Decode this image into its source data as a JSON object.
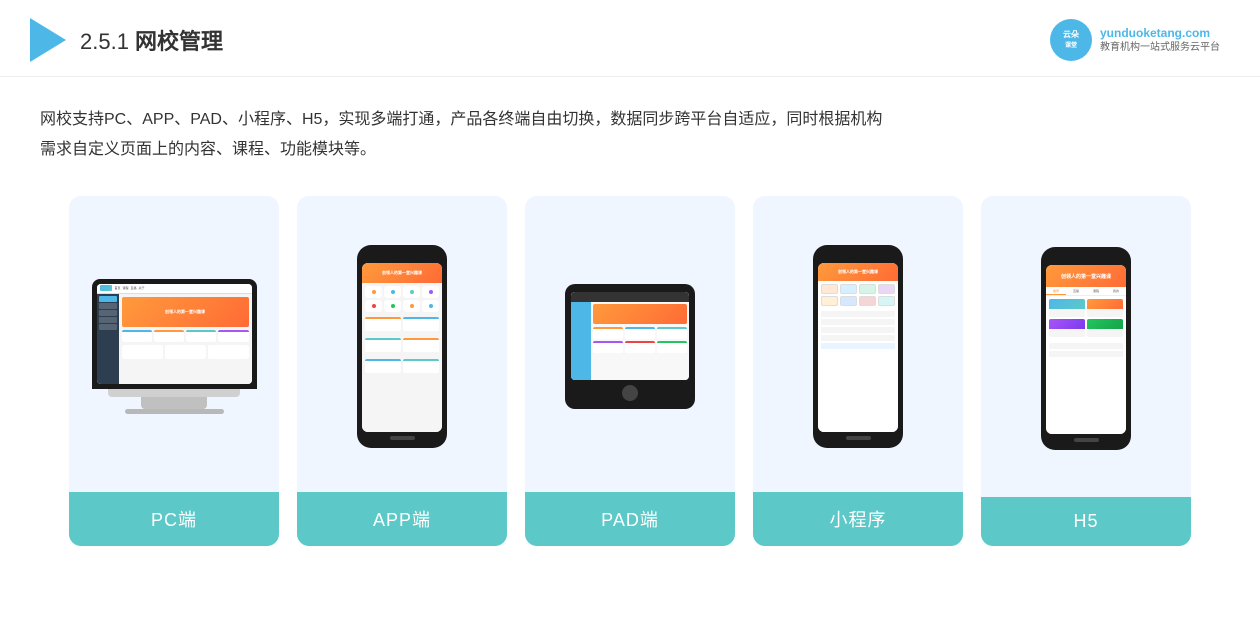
{
  "header": {
    "title_prefix": "2.5.1 ",
    "title_main": "网校管理",
    "brand": {
      "name": "云朵课堂",
      "url": "yunduoketang.com",
      "tagline": "教育机构一站式服务云平台"
    }
  },
  "description": {
    "line1": "网校支持PC、APP、PAD、小程序、H5，实现多端打通，产品各终端自由切换，数据同步跨平台自适应，同时根据机构",
    "line2": "需求自定义页面上的内容、课程、功能模块等。"
  },
  "cards": [
    {
      "id": "pc",
      "label": "PC端"
    },
    {
      "id": "app",
      "label": "APP端"
    },
    {
      "id": "pad",
      "label": "PAD端"
    },
    {
      "id": "miniapp",
      "label": "小程序"
    },
    {
      "id": "h5",
      "label": "H5"
    }
  ]
}
